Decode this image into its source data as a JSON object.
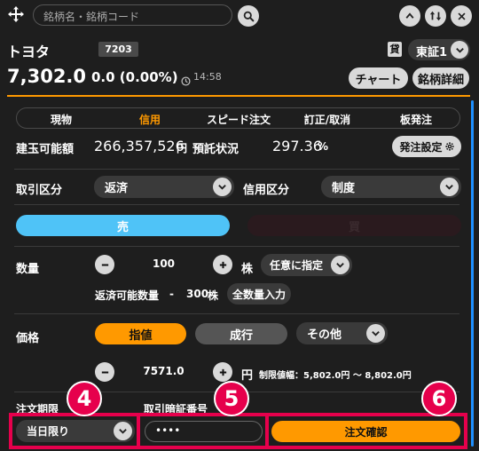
{
  "header": {
    "search_placeholder": "銘柄名・銘柄コード"
  },
  "stock": {
    "name": "トヨタ",
    "code": "7203",
    "market_badge": "貸",
    "market": "東証1",
    "price": "7,302.0",
    "change": "0.0 (0.00%)",
    "time": "14:58",
    "chart_button": "チャート",
    "detail_button": "銘柄詳細"
  },
  "tabs": [
    {
      "label": "現物"
    },
    {
      "label": "信用"
    },
    {
      "label": "スピード注文"
    },
    {
      "label": "訂正/取消"
    },
    {
      "label": "板発注"
    }
  ],
  "account": {
    "buying_power_label": "建玉可能額",
    "buying_power_value": "266,357,526",
    "buying_power_unit": "円",
    "margin_label": "預託状況",
    "margin_value": "297.36",
    "margin_unit": "%",
    "settings_button": "発注設定"
  },
  "trade_type": {
    "label": "取引区分",
    "value": "返済",
    "credit_label": "信用区分",
    "credit_value": "制度"
  },
  "side": {
    "sell": "売",
    "buy": "買"
  },
  "quantity": {
    "label": "数量",
    "value": "100",
    "unit": "株",
    "mode": "任意に指定",
    "available_label": "返済可能数量",
    "available_dash": "-",
    "available_value": "300",
    "available_unit": "株",
    "all_button": "全数量入力"
  },
  "price": {
    "label": "価格",
    "limit": "指値",
    "market": "成行",
    "other": "その他",
    "value": "7571.0",
    "unit": "円",
    "range": "制限値幅：5,802.0円 ～ 8,802.0円"
  },
  "order": {
    "period_label": "注文期限",
    "period_value": "当日限り",
    "pin_label": "取引暗証番号",
    "pin_value": "••••",
    "confirm_button": "注文確認"
  },
  "annotations": {
    "b4": "4",
    "b5": "5",
    "b6": "6"
  },
  "colors": {
    "accent_orange": "#ff9900",
    "sell_blue": "#4fc3f7",
    "highlight_pink": "#e6004c"
  }
}
